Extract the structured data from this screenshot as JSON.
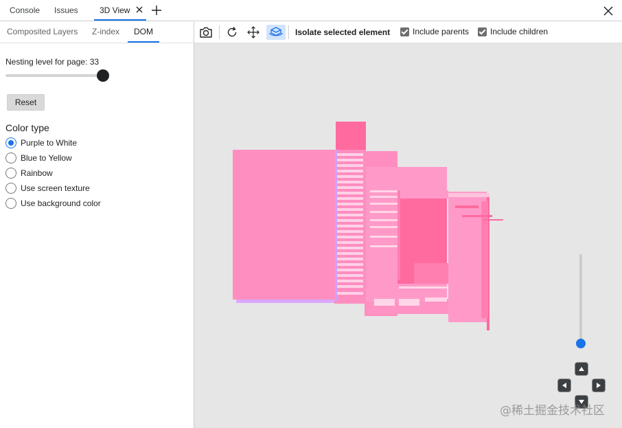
{
  "drawer_tabs": {
    "console": "Console",
    "issues": "Issues",
    "view3d": "3D View"
  },
  "subtabs": {
    "composited": "Composited Layers",
    "zindex": "Z-index",
    "dom": "DOM"
  },
  "nesting": {
    "label": "Nesting level for page: 33",
    "value": 33
  },
  "reset_label": "Reset",
  "color_type": {
    "title": "Color type",
    "options": [
      {
        "label": "Purple to White",
        "checked": true
      },
      {
        "label": "Blue to Yellow",
        "checked": false
      },
      {
        "label": "Rainbow",
        "checked": false
      },
      {
        "label": "Use screen texture",
        "checked": false
      },
      {
        "label": "Use background color",
        "checked": false
      }
    ]
  },
  "toolbar": {
    "isolate_label": "Isolate selected element",
    "include_parents": "Include parents",
    "include_children": "Include children",
    "icons": [
      "camera-icon",
      "reset-view-icon",
      "pan-icon",
      "rotate-3d-icon"
    ]
  },
  "watermark": "@稀土掘金技术社区",
  "colors": {
    "accent": "#1a73e8",
    "layer_pink": "#ff8ec0",
    "layer_dark_pink": "#ff6a9f",
    "layer_light": "#ffc4dd",
    "layer_purple": "#d6a6ff",
    "viewport_bg": "#e6e6e6"
  }
}
